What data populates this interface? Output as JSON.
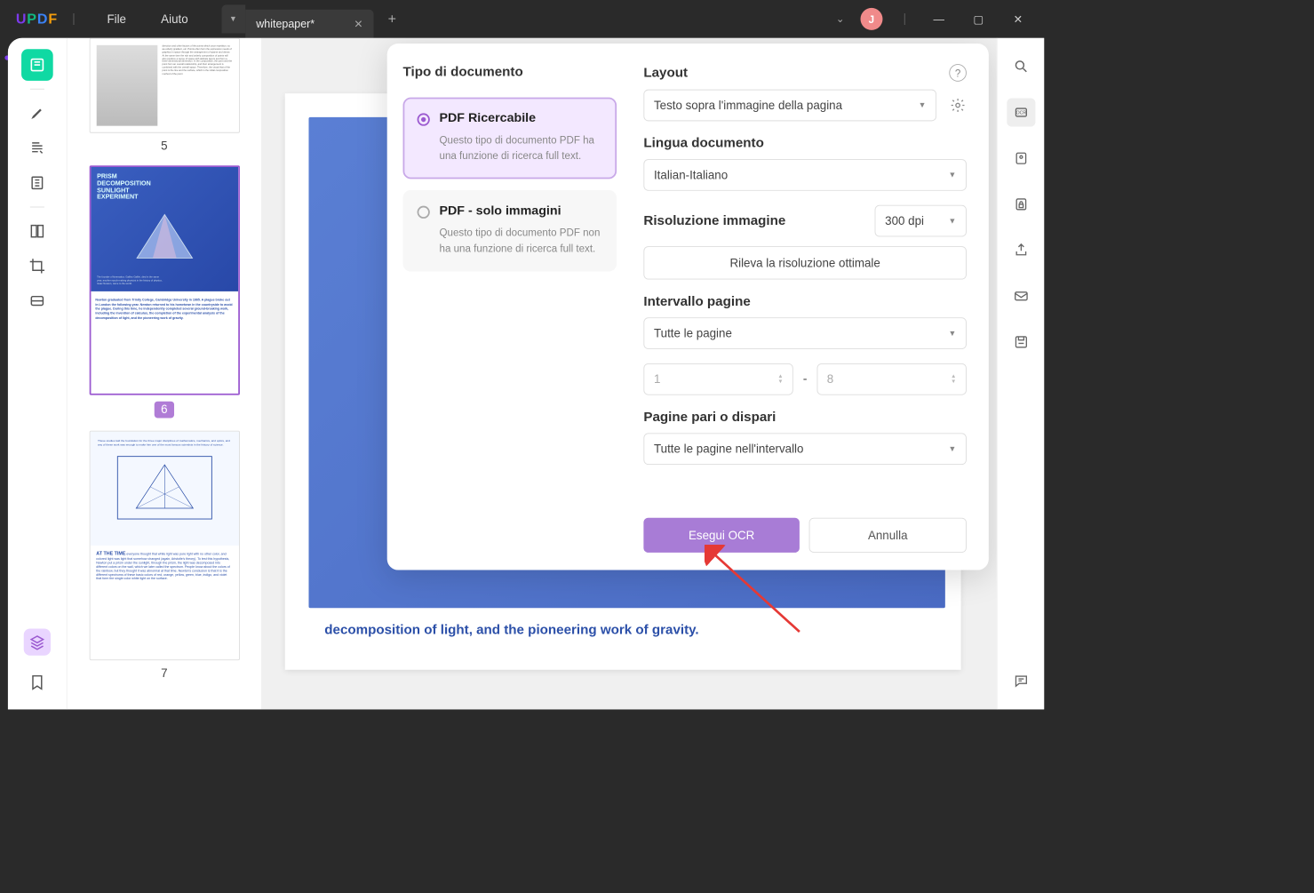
{
  "menu": {
    "file": "File",
    "help": "Aiuto"
  },
  "tab": {
    "title": "whitepaper*"
  },
  "avatar": {
    "letter": "J"
  },
  "thumbs": {
    "p5": "5",
    "p6": "6",
    "p7": "7"
  },
  "ocr": {
    "doctype_heading": "Tipo di documento",
    "searchable": {
      "title": "PDF Ricercabile",
      "desc": "Questo tipo di documento PDF ha una funzione di ricerca full text."
    },
    "imageonly": {
      "title": "PDF - solo immagini",
      "desc": "Questo tipo di documento PDF non ha una funzione di ricerca full text."
    },
    "layout_label": "Layout",
    "layout_value": "Testo sopra l'immagine della pagina",
    "lang_label": "Lingua documento",
    "lang_value": "Italian-Italiano",
    "res_label": "Risoluzione immagine",
    "res_value": "300 dpi",
    "detect_btn": "Rileva la risoluzione ottimale",
    "range_label": "Intervallo pagine",
    "range_value": "Tutte le pagine",
    "range_from": "1",
    "range_to": "8",
    "oddeven_label": "Pagine pari o dispari",
    "oddeven_value": "Tutte le pagine nell'intervallo",
    "run_btn": "Esegui OCR",
    "cancel_btn": "Annulla"
  },
  "doc_bottom_text": "decomposition of light, and the pioneering work of gravity.",
  "t6": {
    "title": "PRISM\nDECOMPOSITION\nSUNLIGHT\nEXPERIMENT"
  },
  "t7": {
    "heading": "AT THE TIME"
  }
}
